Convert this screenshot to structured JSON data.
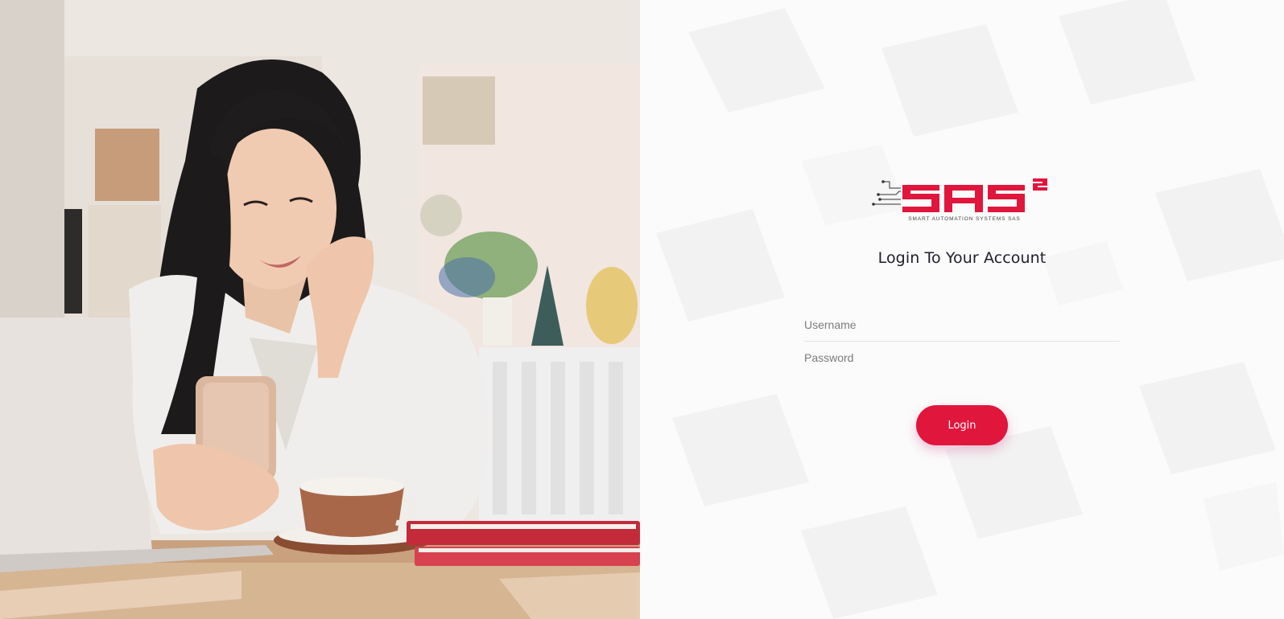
{
  "brand": {
    "logo_text": "SAS",
    "logo_superscript": "2",
    "tagline": "SMART AUTOMATION SYSTEMS SAS",
    "accent_color": "#e0163d"
  },
  "login": {
    "title": "Login To Your Account",
    "username_placeholder": "Username",
    "password_placeholder": "Password",
    "button_label": "Login"
  },
  "hero": {
    "description": "woman smiling at phone beside laptop, coffee cup and notebooks"
  }
}
